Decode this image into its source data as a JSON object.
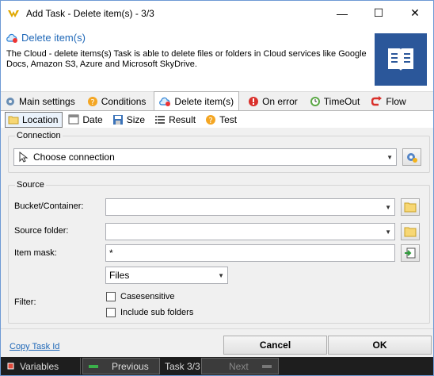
{
  "window": {
    "title": "Add Task - Delete item(s) - 3/3",
    "minimize": "—",
    "maximize": "☐",
    "close": "✕"
  },
  "header": {
    "title": "Delete item(s)",
    "description": "The Cloud - delete items(s) Task is able to delete files or folders in Cloud services like Google Docs, Amazon S3, Azure and Microsoft SkyDrive."
  },
  "tabs": [
    {
      "label": "Main settings"
    },
    {
      "label": "Conditions"
    },
    {
      "label": "Delete item(s)"
    },
    {
      "label": "On error"
    },
    {
      "label": "TimeOut"
    },
    {
      "label": "Flow"
    }
  ],
  "subtabs": [
    {
      "label": "Location"
    },
    {
      "label": "Date"
    },
    {
      "label": "Size"
    },
    {
      "label": "Result"
    },
    {
      "label": "Test"
    }
  ],
  "connection": {
    "legend": "Connection",
    "value": "Choose connection"
  },
  "source": {
    "legend": "Source",
    "bucket_label": "Bucket/Container:",
    "bucket_value": "",
    "folder_label": "Source folder:",
    "folder_value": "",
    "mask_label": "Item mask:",
    "mask_value": "*",
    "filter_label": "Filter:",
    "filter_type": "Files",
    "case_sensitive": "Casesensitive",
    "include_sub": "Include sub folders"
  },
  "footer": {
    "copy_link": "Copy Task Id",
    "cancel": "Cancel",
    "ok": "OK"
  },
  "statusbar": {
    "variables": "Variables",
    "previous": "Previous",
    "task_counter": "Task 3/3",
    "next": "Next"
  }
}
